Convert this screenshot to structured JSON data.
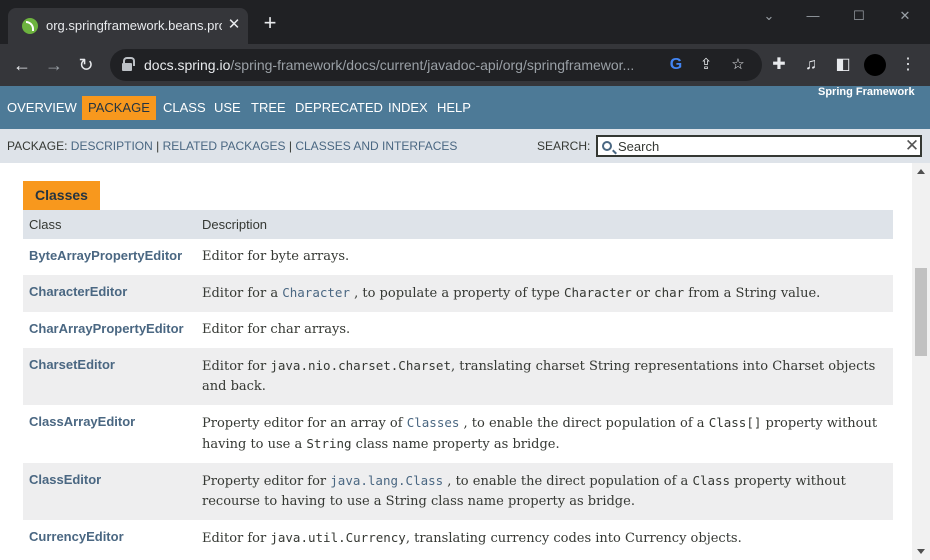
{
  "browser": {
    "tab_title": "org.springframework.beans.prop",
    "url_host": "docs.spring.io",
    "url_path": "/spring-framework/docs/current/javadoc-api/org/springframewor...",
    "google_icon_glyph": "G"
  },
  "javadoc": {
    "nav": [
      "OVERVIEW",
      "PACKAGE",
      "CLASS",
      "USE",
      "TREE",
      "DEPRECATED",
      "INDEX",
      "HELP"
    ],
    "active_nav": "PACKAGE",
    "brand": "Spring Framework",
    "subnav": {
      "prefix": "PACKAGE: ",
      "links": [
        "DESCRIPTION",
        "RELATED PACKAGES",
        "CLASSES AND INTERFACES"
      ],
      "separator": " | "
    },
    "search": {
      "label": "SEARCH:",
      "placeholder": "Search"
    },
    "classes": {
      "caption": "Classes",
      "headers": [
        "Class",
        "Description"
      ],
      "rows": [
        {
          "name": "ByteArrayPropertyEditor",
          "parts": [
            {
              "t": "Editor for byte arrays."
            }
          ]
        },
        {
          "name": "CharacterEditor",
          "parts": [
            {
              "t": "Editor for a "
            },
            {
              "t": "Character",
              "code": true,
              "link": true
            },
            {
              "t": " , to populate a property of type "
            },
            {
              "t": "Character",
              "code": true
            },
            {
              "t": " or "
            },
            {
              "t": "char",
              "code": true
            },
            {
              "t": " from a String value."
            }
          ]
        },
        {
          "name": "CharArrayPropertyEditor",
          "parts": [
            {
              "t": "Editor for char arrays."
            }
          ]
        },
        {
          "name": "CharsetEditor",
          "parts": [
            {
              "t": "Editor for "
            },
            {
              "t": "java.nio.charset.Charset",
              "code": true
            },
            {
              "t": ", translating charset String representations into Charset objects and back."
            }
          ]
        },
        {
          "name": "ClassArrayEditor",
          "parts": [
            {
              "t": "Property editor for an array of "
            },
            {
              "t": "Classes",
              "code": true,
              "link": true
            },
            {
              "t": " , to enable the direct population of a "
            },
            {
              "t": "Class[]",
              "code": true
            },
            {
              "t": " property without having to use a "
            },
            {
              "t": "String",
              "code": true
            },
            {
              "t": " class name property as bridge."
            }
          ]
        },
        {
          "name": "ClassEditor",
          "parts": [
            {
              "t": "Property editor for "
            },
            {
              "t": "java.lang.Class",
              "code": true,
              "link": true
            },
            {
              "t": " , to enable the direct population of a "
            },
            {
              "t": "Class",
              "code": true
            },
            {
              "t": " property without recourse to having to use a String class name property as bridge."
            }
          ]
        },
        {
          "name": "CurrencyEditor",
          "parts": [
            {
              "t": "Editor for "
            },
            {
              "t": "java.util.Currency",
              "code": true
            },
            {
              "t": ", translating currency codes into Currency objects."
            }
          ]
        }
      ]
    }
  },
  "colors": {
    "nav_bg": "#4d7a97",
    "active_tab": "#f8981d",
    "subnav_bg": "#dee3e9",
    "link": "#4a6782"
  }
}
